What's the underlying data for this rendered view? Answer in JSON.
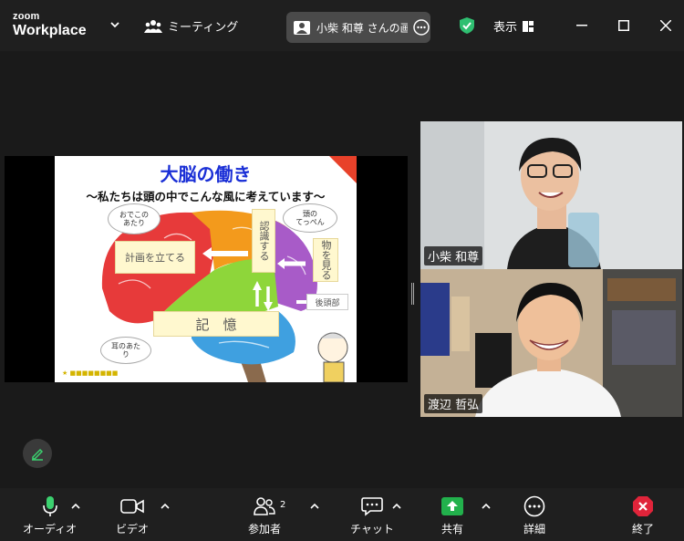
{
  "titlebar": {
    "logo_top": "zoom",
    "logo_bottom": "Workplace",
    "meeting_label": "ミーティング",
    "share_label": "小柴 和尊 さんの画",
    "view_label": "表示"
  },
  "slide": {
    "title": "大脳の働き",
    "subtitle": "〜私たちは頭の中でこんな風に考えています〜",
    "labels": {
      "plan": "計画を立てる",
      "recognize": "認識する",
      "see": "物を見る",
      "memory": "記　憶",
      "occipital": "後頭部"
    },
    "bubbles": {
      "forehead": "おでこの\nあたり",
      "top": "頭の\nてっぺん",
      "ear": "耳のあた\nり"
    }
  },
  "participants": [
    {
      "name": "小柴 和尊"
    },
    {
      "name": "渡辺 哲弘"
    }
  ],
  "toolbar": {
    "audio": "オーディオ",
    "video": "ビデオ",
    "participants": "参加者",
    "participants_count": "2",
    "chat": "チャット",
    "share": "共有",
    "details": "詳細",
    "end": "終了"
  },
  "colors": {
    "share_green": "#22b14c",
    "end_red": "#e0243a",
    "shield_green": "#2fbf71"
  }
}
